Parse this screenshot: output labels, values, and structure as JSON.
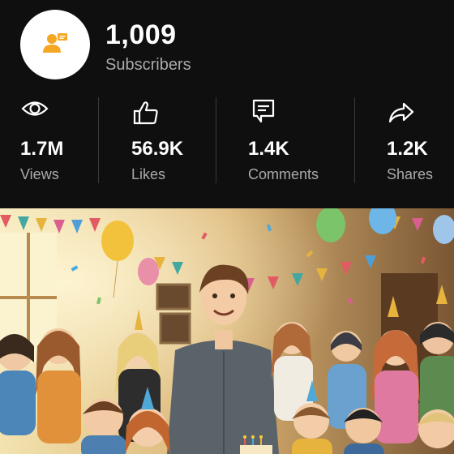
{
  "channel": {
    "subscriber_count": "1,009",
    "subscriber_label": "Subscribers",
    "avatar_icon": "person-badge-icon",
    "accent": "#f5a623"
  },
  "stats": [
    {
      "value": "1.7M",
      "label": "Views",
      "icon": "eye-icon"
    },
    {
      "value": "56.9K",
      "label": "Likes",
      "icon": "thumbs-up-icon"
    },
    {
      "value": "1.4K",
      "label": "Comments",
      "icon": "comment-icon"
    },
    {
      "value": "1.2K",
      "label": "Shares",
      "icon": "share-icon"
    }
  ],
  "thumbnail": {
    "kind": "video-thumbnail"
  }
}
